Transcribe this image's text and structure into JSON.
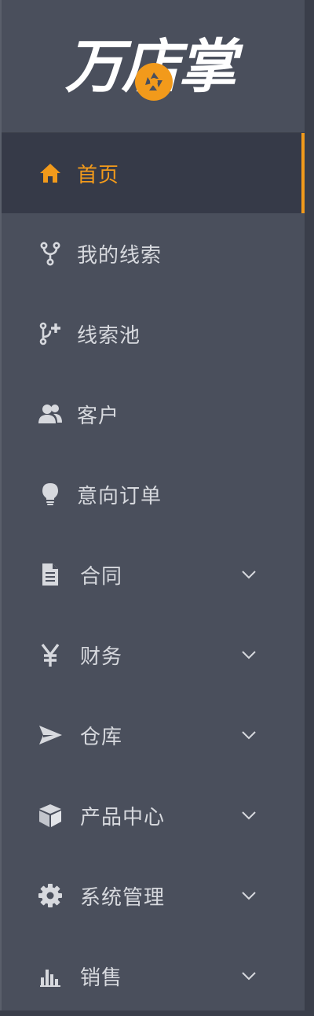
{
  "brand": {
    "logo_text": "万店掌",
    "accent_color": "#f29a1b",
    "sidebar_bg": "#4a4f5c",
    "active_bg": "#363a48"
  },
  "nav": [
    {
      "label": "首页",
      "icon": "home-icon",
      "active": true,
      "has_submenu": false
    },
    {
      "label": "我的线索",
      "icon": "fork-icon",
      "active": false,
      "has_submenu": false
    },
    {
      "label": "线索池",
      "icon": "branch-plus-icon",
      "active": false,
      "has_submenu": false
    },
    {
      "label": "客户",
      "icon": "users-icon",
      "active": false,
      "has_submenu": false
    },
    {
      "label": "意向订单",
      "icon": "lightbulb-icon",
      "active": false,
      "has_submenu": false
    },
    {
      "label": "合同",
      "icon": "document-icon",
      "active": false,
      "has_submenu": true
    },
    {
      "label": "财务",
      "icon": "yen-icon",
      "active": false,
      "has_submenu": true
    },
    {
      "label": "仓库",
      "icon": "send-icon",
      "active": false,
      "has_submenu": true
    },
    {
      "label": "产品中心",
      "icon": "cube-icon",
      "active": false,
      "has_submenu": true
    },
    {
      "label": "系统管理",
      "icon": "gear-icon",
      "active": false,
      "has_submenu": true
    },
    {
      "label": "销售",
      "icon": "bar-chart-icon",
      "active": false,
      "has_submenu": true
    }
  ]
}
